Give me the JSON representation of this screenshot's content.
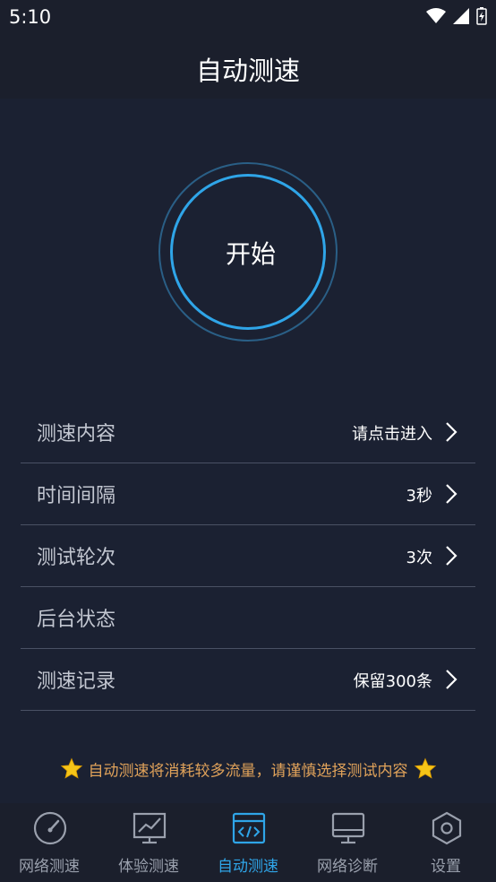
{
  "status_bar": {
    "time": "5:10"
  },
  "header": {
    "title": "自动测速"
  },
  "start_button": {
    "label": "开始"
  },
  "settings": [
    {
      "label": "测速内容",
      "value": "请点击进入",
      "has_chevron": true
    },
    {
      "label": "时间间隔",
      "value": "3秒",
      "has_chevron": true
    },
    {
      "label": "测试轮次",
      "value": "3次",
      "has_chevron": true
    },
    {
      "label": "后台状态",
      "value": "",
      "has_chevron": false
    },
    {
      "label": "测速记录",
      "value": "保留300条",
      "has_chevron": true
    }
  ],
  "notice": {
    "text": "自动测速将消耗较多流量，请谨慎选择测试内容",
    "icon": "star-icon"
  },
  "bottom_nav": {
    "items": [
      {
        "label": "网络测速",
        "icon": "speedometer-icon",
        "active": false
      },
      {
        "label": "体验测速",
        "icon": "chart-monitor-icon",
        "active": false
      },
      {
        "label": "自动测速",
        "icon": "code-window-icon",
        "active": true
      },
      {
        "label": "网络诊断",
        "icon": "monitor-icon",
        "active": false
      },
      {
        "label": "设置",
        "icon": "hexagon-gear-icon",
        "active": false
      }
    ]
  },
  "colors": {
    "background": "#1b2132",
    "accent": "#2fa5e8",
    "notice": "#e0a25a",
    "star": "#f5c518"
  }
}
